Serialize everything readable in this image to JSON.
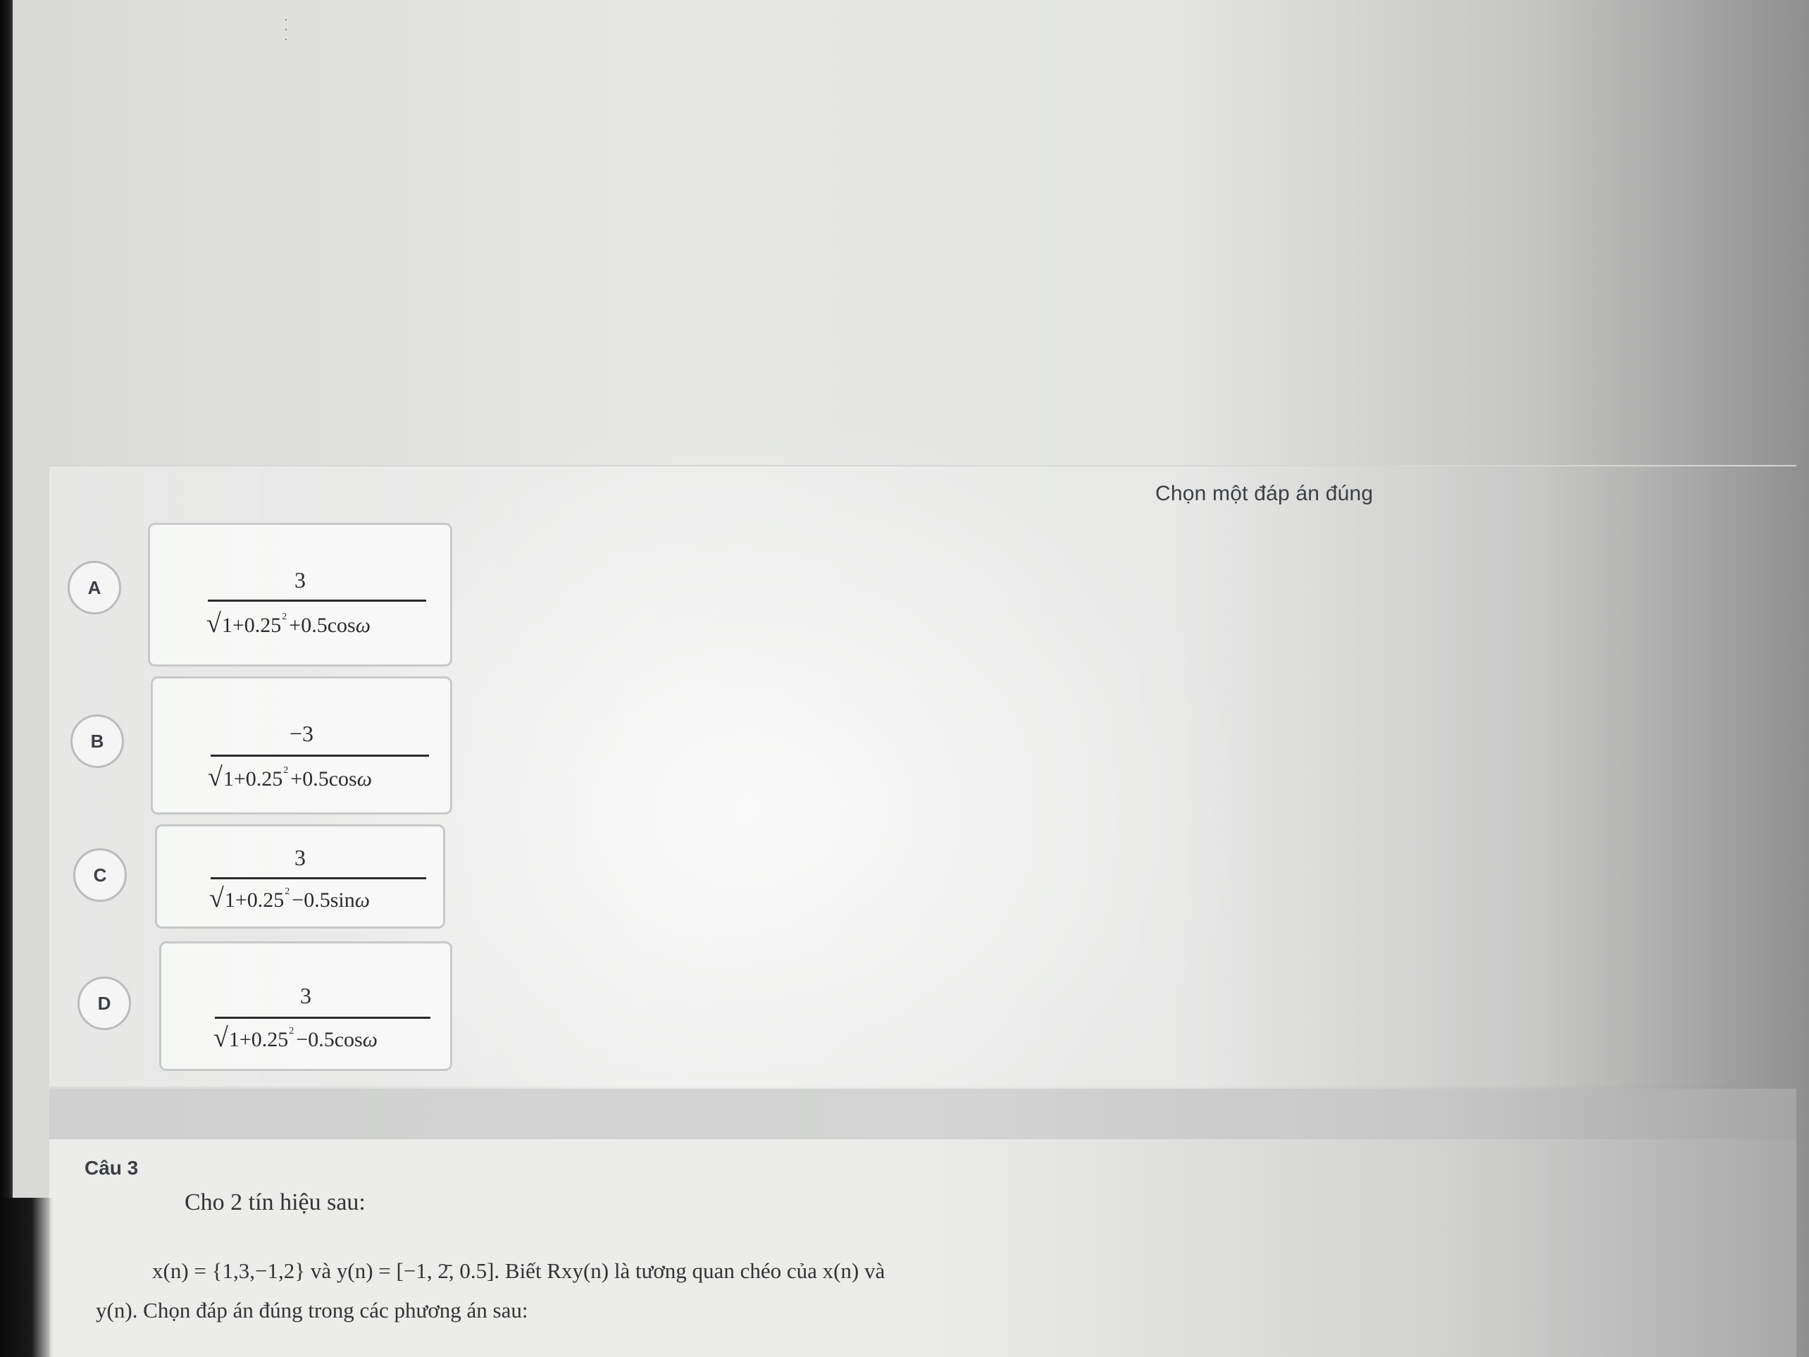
{
  "question_prompt": "Chọn một đáp án đúng",
  "options": [
    {
      "letter": "A",
      "numerator": "3",
      "den_pre": "1+0.25",
      "den_sup": "2",
      "den_post": "+0.5cos",
      "den_var": "ω"
    },
    {
      "letter": "B",
      "numerator": "−3",
      "den_pre": "1+0.25",
      "den_sup": "2",
      "den_post": "+0.5cos",
      "den_var": "ω"
    },
    {
      "letter": "C",
      "numerator": "3",
      "den_pre": "1+0.25",
      "den_sup": "2",
      "den_post": "−0.5sin",
      "den_var": "ω"
    },
    {
      "letter": "D",
      "numerator": "3",
      "den_pre": "1+0.25",
      "den_sup": "2",
      "den_post": "−0.5cos",
      "den_var": "ω"
    }
  ],
  "next_question": {
    "number_label": "Câu 3",
    "intro": "Cho 2 tín hiệu sau:",
    "line1": "x(n) = {1,3,−1,2} và y(n) = [−1, 2̄, 0.5]. Biết Rxy(n) là tương quan chéo của x(n) và",
    "line2": "y(n). Chọn đáp án đúng trong các phương án sau:"
  },
  "colors": {
    "screen_bg": "#e6e7e5",
    "label_text": "#3b3f45",
    "option_border": "#c7c9c9",
    "separator": "#d3d4d3"
  }
}
